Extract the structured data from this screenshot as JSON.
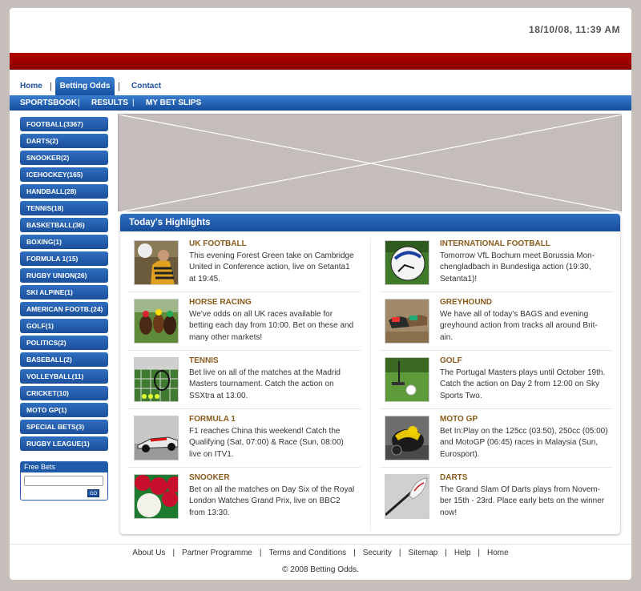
{
  "header": {
    "datetime": "18/10/08, 11:39 AM"
  },
  "top_nav": {
    "home": "Home",
    "betting_odds": "Betting Odds",
    "contact": "Contact",
    "separator": "|"
  },
  "sub_nav": {
    "sportsbook": "SPORTSBOOK",
    "results": "RESULTS",
    "my_bet_slips": "MY BET SLIPS",
    "separator": "|"
  },
  "sidebar": {
    "sports": [
      "FOOTBALL(3367)",
      "DARTS(2)",
      "SNOOKER(2)",
      "ICEHOCKEY(165)",
      "HANDBALL(28)",
      "TENNIS(18)",
      "BASKETBALL(36)",
      "BOXING(1)",
      "FORMULA 1(15)",
      "RUGBY UNION(26)",
      "SKI ALPINE(1)",
      "AMERICAN FOOTB.(24)",
      "GOLF(1)",
      "POLITICS(2)",
      "BASEBALL(2)",
      "VOLLEYBALL(11)",
      "CRICKET(10)",
      "MOTO GP(1)",
      "SPECIAL BETS(3)",
      "RUGBY LEAGUE(1)"
    ]
  },
  "free_bets": {
    "title": "Free Bets",
    "value": "",
    "go_label": "GO"
  },
  "highlights": {
    "title": "Today's Highlights",
    "items": [
      {
        "title": "UK FOOTBALL",
        "text": "This evening Forest Green take on Cambridge United in Conference action, live on Setanta1 at 19:45.",
        "icon": "football-player-image"
      },
      {
        "title": "INTERNATIONAL FOOTBALL",
        "text": "Tomorrow VfL Bochum meet Borussia Mon-chengladbach in Bundesliga action (19:30, Setanta1)!",
        "icon": "soccer-ball-image"
      },
      {
        "title": "HORSE RACING",
        "text": "We've odds on all UK races available for betting each day from 10:00. Bet on these and many other markets!",
        "icon": "horse-racing-image"
      },
      {
        "title": "GREYHOUND",
        "text": "We have all of today's BAGS and evening greyhound action from tracks all around Brit-ain.",
        "icon": "greyhound-image"
      },
      {
        "title": "TENNIS",
        "text": "Bet live on all of the matches at the Madrid Masters tournament. Catch the action on SSXtra at 13:00.",
        "icon": "tennis-image"
      },
      {
        "title": "GOLF",
        "text": "The Portugal Masters plays until October 19th. Catch the action on Day 2 from 12:00 on Sky Sports Two.",
        "icon": "golf-image"
      },
      {
        "title": "FORMULA 1",
        "text": "F1 reaches China this weekend! Catch the Qualifying (Sat, 07:00) & Race (Sun, 08:00) live on ITV1.",
        "icon": "f1-car-image"
      },
      {
        "title": "MOTO GP",
        "text": "Bet In:Play on the 125cc (03:50), 250cc (05:00) and MotoGP (06:45) races in Malaysia (Sun, Eurosport).",
        "icon": "motogp-image"
      },
      {
        "title": "SNOOKER",
        "text": "Bet on all the matches on Day Six of the Royal London Watches Grand Prix, live on BBC2 from 13:30.",
        "icon": "snooker-balls-image"
      },
      {
        "title": "DARTS",
        "text": "The Grand Slam Of Darts plays from Novem-ber 15th - 23rd. Place early bets on the winner now!",
        "icon": "darts-image"
      }
    ]
  },
  "footer": {
    "links": [
      "About Us",
      "Partner Programme",
      "Terms and Conditions",
      "Security",
      "Sitemap",
      "Help",
      "Home"
    ],
    "separator": "|",
    "copyright": "© 2008 Betting Odds."
  }
}
